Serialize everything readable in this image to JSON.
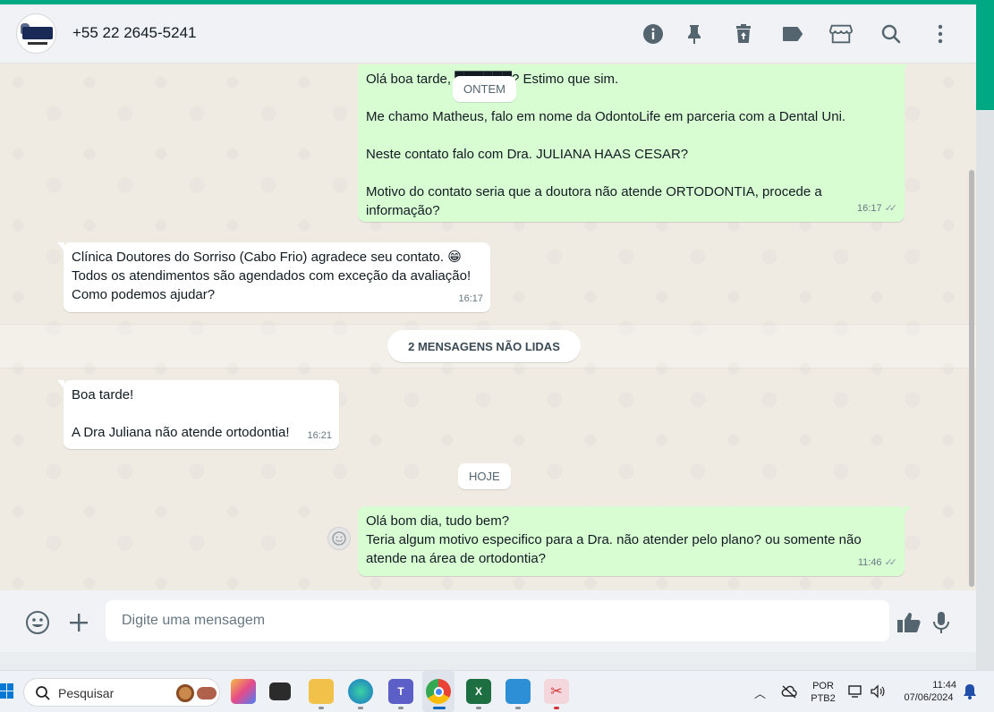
{
  "header": {
    "contact_name": "+55 22 2645-5241",
    "avatar_alt": "Doutores do Sorriso",
    "icons": [
      "info-icon",
      "pin-icon",
      "delete-icon",
      "label-icon",
      "store-icon",
      "search-icon",
      "menu-icon"
    ]
  },
  "messages": [
    {
      "direction": "out",
      "text": "Olá boa tarde, ██████? Estimo que sim.\n\nMe chamo Matheus, falo em nome da OdontoLife em parceria com a Dental Uni.\n\nNeste contato falo com Dra. JULIANA HAAS CESAR?\n\nMotivo do contato seria que a doutora não atende ORTODONTIA, procede a informação?",
      "time": "16:17"
    },
    {
      "direction": "in",
      "text": "Clínica Doutores do Sorriso (Cabo Frio) agradece seu contato. 😁\nTodos os atendimentos são agendados com exceção da avaliação!\nComo podemos ajudar?",
      "time": "16:17"
    },
    {
      "direction": "in",
      "text": "Boa tarde!\n\nA Dra Juliana não atende ortodontia!",
      "time": "16:21"
    },
    {
      "direction": "out",
      "text": "Olá bom dia, tudo bem?\nTeria algum motivo especifico para a Dra. não atender pelo plano? ou somente não atende na área de ortodontia?",
      "time": "11:46"
    }
  ],
  "date_labels": {
    "yesterday": "ONTEM",
    "today": "HOJE"
  },
  "unread_banner": "2 MENSAGENS NÃO LIDAS",
  "composer": {
    "placeholder": "Digite uma mensagem"
  },
  "taskbar": {
    "search_label": "Pesquisar",
    "lang_top": "POR",
    "lang_bottom": "PTB2",
    "time": "11:44",
    "date": "07/06/2024"
  },
  "colors": {
    "accent": "#00a884",
    "outgoing_bubble": "#d9fdd3",
    "incoming_bubble": "#ffffff",
    "chat_bg": "#efeae2"
  }
}
